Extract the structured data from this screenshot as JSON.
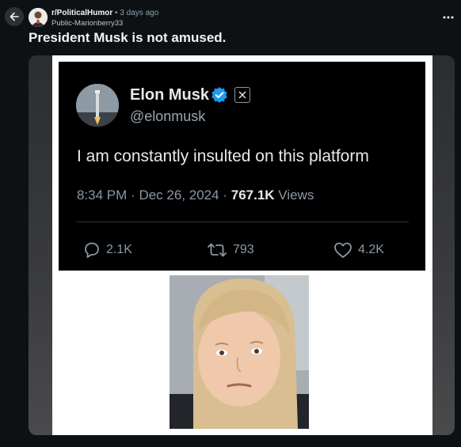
{
  "header": {
    "subreddit": "r/PoliticalHumor",
    "separator": "•",
    "time": "3 days ago",
    "author": "Public-Marionberry33"
  },
  "post": {
    "title": "President Musk is not amused."
  },
  "tweet": {
    "name": "Elon Musk",
    "handle": "@elonmusk",
    "text": "I am constantly insulted on this platform",
    "time": "8:34 PM",
    "dot1": "·",
    "date": "Dec 26, 2024",
    "dot2": "·",
    "views_count": "767.1K",
    "views_label": "Views",
    "replies": "2.1K",
    "reposts": "793",
    "likes": "4.2K"
  },
  "icons": {
    "back": "arrow-left-icon",
    "more": "more-horizontal-icon",
    "verified": "verified-badge-icon",
    "x_logo": "x-logo-icon",
    "reply": "reply-icon",
    "repost": "repost-icon",
    "like": "heart-icon"
  },
  "colors": {
    "background": "#0e1113",
    "verified_blue": "#1d9bf0",
    "secondary_text": "#8ba2ad"
  }
}
